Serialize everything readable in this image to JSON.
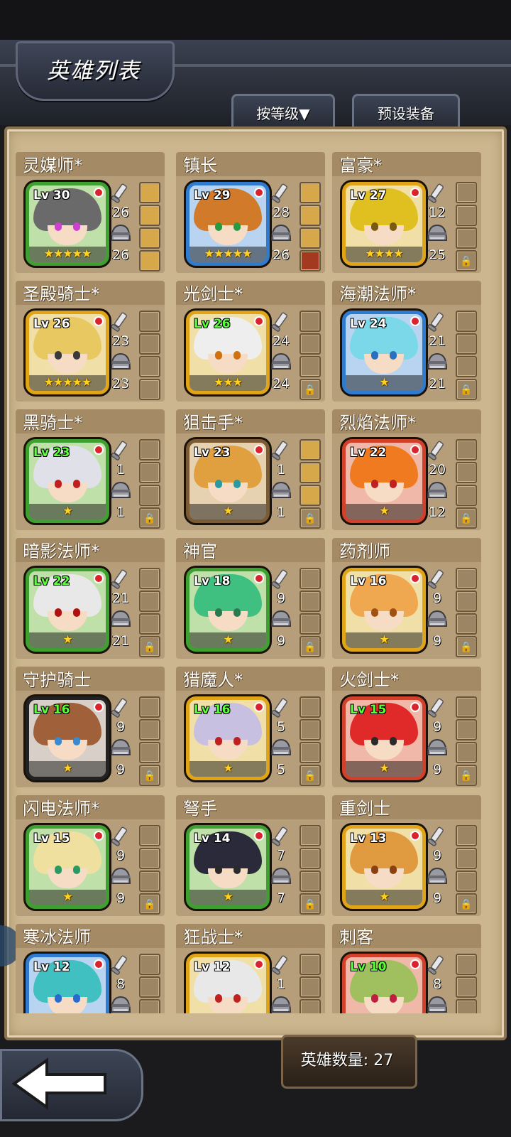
{
  "title": "英雄列表",
  "sort_button": "按等级▼",
  "preset_button": "预设装备",
  "hero_count_label": "英雄数量: 27",
  "heroes": [
    {
      "name": "灵媒师*",
      "level": "Lv 30",
      "atk": "26",
      "def": "26",
      "stars": 5,
      "frame": "green",
      "hair": "#6a6a6a",
      "eye": "#d040d0",
      "slots": [
        "item",
        "item",
        "item",
        "item"
      ],
      "lock": false
    },
    {
      "name": "镇长",
      "level": "Lv 29",
      "atk": "28",
      "def": "26",
      "stars": 5,
      "frame": "blue",
      "hair": "#d07a2a",
      "eye": "#2a9a40",
      "slots": [
        "item",
        "item",
        "item",
        "item-red"
      ],
      "lock": false
    },
    {
      "name": "富豪*",
      "level": "Lv 27",
      "atk": "12",
      "def": "25",
      "stars": 4,
      "frame": "gold",
      "hair": "#e0c020",
      "eye": "#7a5a10",
      "slots": [
        "",
        "",
        "",
        ""
      ],
      "lock": true
    },
    {
      "name": "圣殿骑士*",
      "level": "Lv 26",
      "atk": "23",
      "def": "23",
      "stars": 5,
      "frame": "gold",
      "hair": "#e8c860",
      "eye": "#3a3a3a",
      "slots": [
        "",
        "",
        "",
        ""
      ],
      "lock": false
    },
    {
      "name": "光剑士*",
      "level": "Lv 26",
      "level_green": true,
      "atk": "24",
      "def": "24",
      "stars": 3,
      "frame": "gold",
      "hair": "#eeeeee",
      "eye": "#d07010",
      "slots": [
        "",
        "",
        "",
        ""
      ],
      "lock": true
    },
    {
      "name": "海潮法师*",
      "level": "Lv 24",
      "atk": "21",
      "def": "21",
      "stars": 1,
      "frame": "blue",
      "hair": "#7ad8e8",
      "eye": "#2a70c0",
      "slots": [
        "",
        "",
        "",
        ""
      ],
      "lock": true
    },
    {
      "name": "黑骑士*",
      "level": "Lv 23",
      "level_green": true,
      "atk": "1",
      "def": "1",
      "stars": 1,
      "frame": "green",
      "hair": "#e0e0e8",
      "eye": "#c02020",
      "slots": [
        "",
        "",
        "",
        ""
      ],
      "lock": true
    },
    {
      "name": "狙击手*",
      "level": "Lv 23",
      "atk": "1",
      "def": "1",
      "stars": 1,
      "frame": "brown",
      "hair": "#e0a040",
      "eye": "#2a9aa0",
      "slots": [
        "item",
        "item",
        "item",
        ""
      ],
      "lock": true
    },
    {
      "name": "烈焰法师*",
      "level": "Lv 22",
      "atk": "20",
      "def": "12",
      "stars": 1,
      "frame": "red",
      "hair": "#f07a20",
      "eye": "#c02020",
      "slots": [
        "",
        "",
        "",
        ""
      ],
      "lock": true
    },
    {
      "name": "暗影法师*",
      "level": "Lv 22",
      "level_green": true,
      "atk": "21",
      "def": "21",
      "stars": 1,
      "frame": "green",
      "hair": "#e8e8e8",
      "eye": "#b01010",
      "slots": [
        "",
        "",
        "",
        ""
      ],
      "lock": true
    },
    {
      "name": "神官",
      "level": "Lv 18",
      "atk": "9",
      "def": "9",
      "stars": 1,
      "frame": "green",
      "hair": "#40c080",
      "eye": "#2a7a50",
      "slots": [
        "",
        "",
        "",
        ""
      ],
      "lock": true
    },
    {
      "name": "药剂师",
      "level": "Lv 16",
      "atk": "9",
      "def": "9",
      "stars": 1,
      "frame": "gold",
      "hair": "#f0a850",
      "eye": "#a05010",
      "slots": [
        "",
        "",
        "",
        ""
      ],
      "lock": true
    },
    {
      "name": "守护骑士",
      "level": "Lv 16",
      "level_green": true,
      "atk": "9",
      "def": "9",
      "stars": 1,
      "frame": "dark",
      "hair": "#a0603a",
      "eye": "#3a8ad0",
      "slots": [
        "",
        "",
        "",
        ""
      ],
      "lock": true
    },
    {
      "name": "猎魔人*",
      "level": "Lv 16",
      "level_green": true,
      "atk": "5",
      "def": "5",
      "stars": 1,
      "frame": "gold",
      "hair": "#c8c0e0",
      "eye": "#c02020",
      "slots": [
        "",
        "",
        "",
        ""
      ],
      "lock": true
    },
    {
      "name": "火剑士*",
      "level": "Lv 15",
      "level_green": true,
      "atk": "9",
      "def": "9",
      "stars": 1,
      "frame": "red",
      "hair": "#e02a2a",
      "eye": "#2a2a2a",
      "slots": [
        "",
        "",
        "",
        ""
      ],
      "lock": true
    },
    {
      "name": "闪电法师*",
      "level": "Lv 15",
      "atk": "9",
      "def": "9",
      "stars": 1,
      "frame": "green",
      "hair": "#f0e0a0",
      "eye": "#2a9a60",
      "slots": [
        "",
        "",
        "",
        ""
      ],
      "lock": true
    },
    {
      "name": "弩手",
      "level": "Lv 14",
      "atk": "7",
      "def": "7",
      "stars": 1,
      "frame": "green",
      "hair": "#2a2a3a",
      "eye": "#2a2a2a",
      "slots": [
        "",
        "",
        "",
        ""
      ],
      "lock": true
    },
    {
      "name": "重剑士",
      "level": "Lv 13",
      "atk": "9",
      "def": "9",
      "stars": 1,
      "frame": "gold",
      "hair": "#e09a40",
      "eye": "#8a4010",
      "slots": [
        "",
        "",
        "",
        ""
      ],
      "lock": true
    },
    {
      "name": "寒冰法师",
      "level": "Lv 12",
      "atk": "8",
      "def": "",
      "stars": 0,
      "frame": "blue",
      "hair": "#40c0c0",
      "eye": "#2a6ad0",
      "slots": [
        "",
        "",
        "",
        ""
      ],
      "lock": false
    },
    {
      "name": "狂战士*",
      "level": "Lv 12",
      "atk": "1",
      "def": "",
      "stars": 0,
      "frame": "gold",
      "hair": "#e8e8e8",
      "eye": "#c02020",
      "slots": [
        "",
        "",
        "",
        ""
      ],
      "lock": false
    },
    {
      "name": "刺客",
      "level": "Lv 10",
      "level_green": true,
      "atk": "8",
      "def": "",
      "stars": 0,
      "frame": "red",
      "hair": "#a0c060",
      "eye": "#c02040",
      "slots": [
        "",
        "",
        "",
        ""
      ],
      "lock": false
    }
  ]
}
